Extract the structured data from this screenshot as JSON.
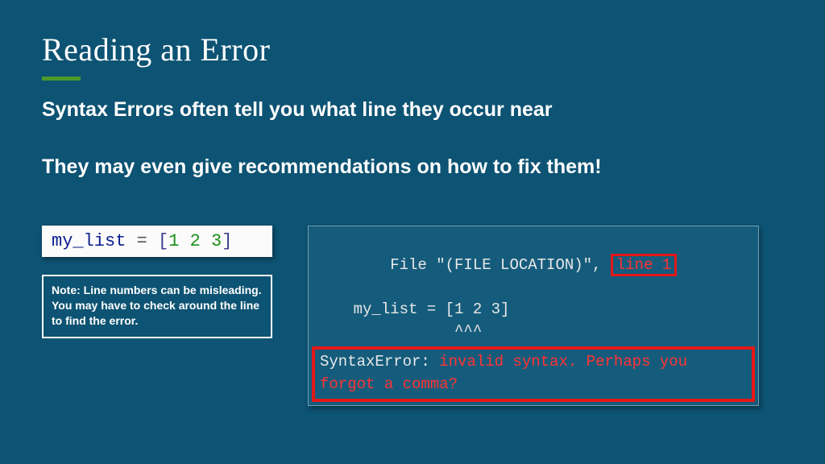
{
  "title": "Reading an Error",
  "subtitle1": "Syntax Errors often tell you what line they occur near",
  "subtitle2": "They may even give recommendations on how to fix them!",
  "code": {
    "name": "my_list",
    "eq": " = ",
    "lbr": "[",
    "n1": "1",
    "sp": " ",
    "n2": "2",
    "n3": "3",
    "rbr": "]"
  },
  "note": {
    "l1": "Note: Line numbers can be misleading.",
    "l2": " You may have to check around the line to find the error."
  },
  "err": {
    "filePrefix": "File \"(FILE LOCATION)\", ",
    "lineTag": "line 1",
    "codeLine": "    my_list = [1 2 3]",
    "caret": "               ^^^",
    "label": "SyntaxError: ",
    "msg": "invalid syntax. Perhaps you forgot a comma?"
  }
}
